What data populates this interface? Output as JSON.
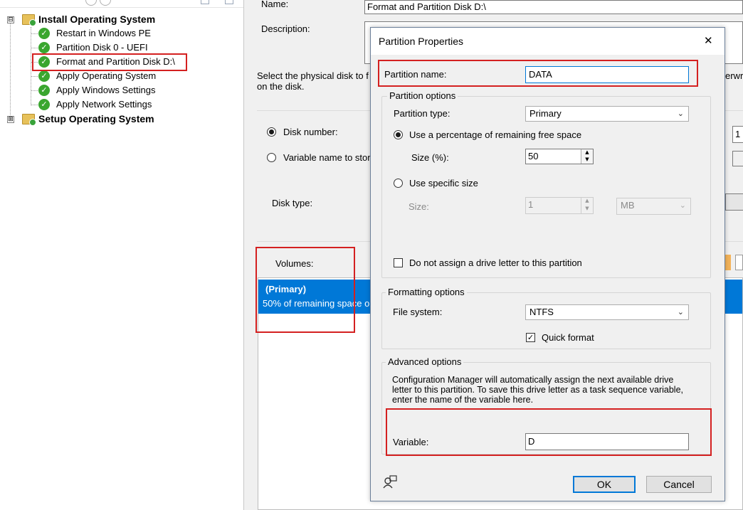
{
  "tree": {
    "groups": [
      {
        "label": "Install Operating System",
        "expander": "⊟",
        "steps": [
          "Restart in Windows PE",
          "Partition Disk 0 - UEFI",
          "Format and Partition Disk D:\\",
          "Apply Operating System",
          "Apply Windows Settings",
          "Apply Network Settings"
        ]
      },
      {
        "label": "Setup Operating System",
        "expander": "⊞"
      }
    ],
    "selected_step": "Format and Partition Disk D:\\"
  },
  "editor": {
    "name_label": "Name:",
    "name_value": "Format and Partition Disk D:\\",
    "description_label": "Description:",
    "instructions_line1": "Select the physical disk to f",
    "instructions_line2": "on the disk.",
    "instructions_right_fragment": "erwri",
    "disk_number_label": "Disk number:",
    "disk_number_value": "1",
    "variable_name_label": "Variable name to stor",
    "disk_type_label": "Disk type:",
    "volumes_label": "Volumes:",
    "volume_item": {
      "title": "(Primary)",
      "detail": "50% of remaining space o"
    }
  },
  "dialog": {
    "title": "Partition Properties",
    "close_glyph": "✕",
    "partition_name_label": "Partition name:",
    "partition_name_value": "DATA",
    "partition_options": {
      "title": "Partition options",
      "type_label": "Partition type:",
      "type_value": "Primary",
      "use_percentage_label": "Use a percentage of remaining free space",
      "size_pct_label": "Size (%):",
      "size_pct_value": "50",
      "use_specific_label": "Use specific size",
      "size_label": "Size:",
      "size_value": "1",
      "unit_value": "MB",
      "no_drive_letter_label": "Do not assign a drive letter to this partition",
      "selected_mode": "percentage"
    },
    "formatting_options": {
      "title": "Formatting options",
      "fs_label": "File system:",
      "fs_value": "NTFS",
      "quick_format_label": "Quick format",
      "quick_format_checked": true
    },
    "advanced_options": {
      "title": "Advanced options",
      "description_line1": "Configuration Manager will automatically assign the next available drive",
      "description_line2": "letter to this partition. To save this drive letter as a task sequence variable,",
      "description_line3": "enter the name of the variable here.",
      "variable_label": "Variable:",
      "variable_value": "D"
    },
    "buttons": {
      "ok": "OK",
      "cancel": "Cancel"
    },
    "check_glyph": "✓"
  },
  "colors": {
    "selection_blue": "#0078d7",
    "annotation_red": "#d42020",
    "check_green": "#3aa62f"
  }
}
